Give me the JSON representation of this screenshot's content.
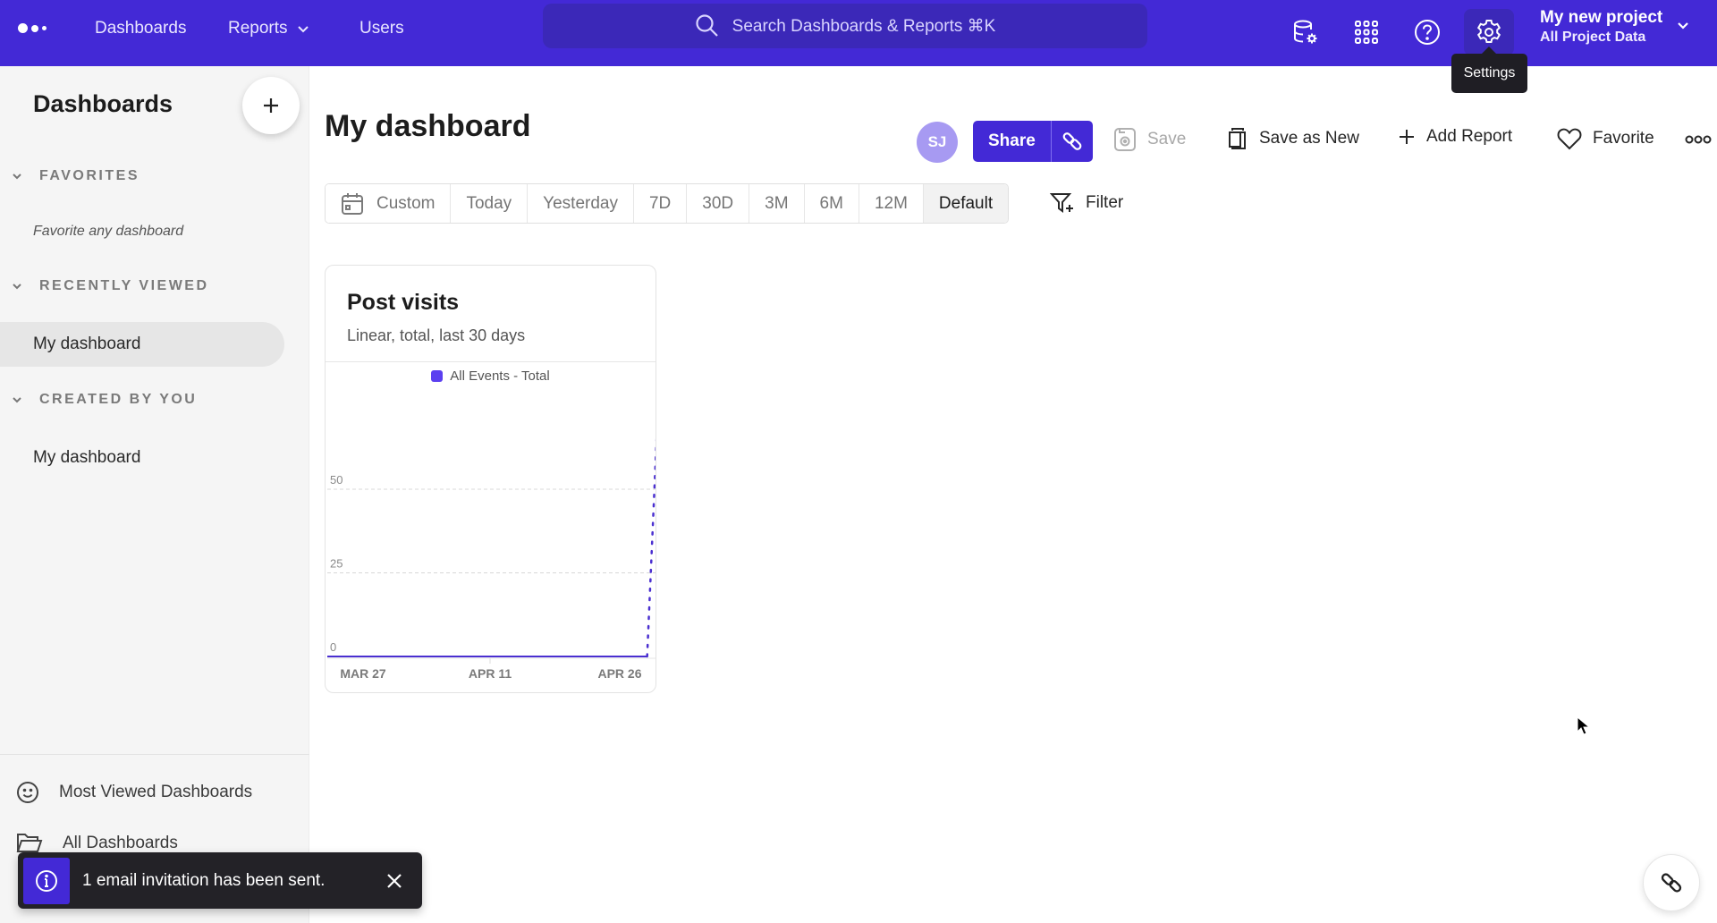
{
  "topbar": {
    "nav": [
      {
        "label": "Dashboards"
      },
      {
        "label": "Reports",
        "has_dropdown": true
      },
      {
        "label": "Users"
      }
    ],
    "search_placeholder": "Search Dashboards & Reports ⌘K",
    "icons": [
      "data-settings-icon",
      "apps-grid-icon",
      "help-icon",
      "settings-icon"
    ],
    "active_icon": "settings-icon",
    "tooltip": "Settings",
    "project": {
      "name": "My new project",
      "subtitle": "All Project Data"
    },
    "brand_color": "#4329d6"
  },
  "sidebar": {
    "title": "Dashboards",
    "sections": [
      {
        "label": "FAVORITES",
        "empty_text": "Favorite any dashboard",
        "items": []
      },
      {
        "label": "RECENTLY VIEWED",
        "items": [
          {
            "label": "My dashboard",
            "active": true
          }
        ]
      },
      {
        "label": "CREATED BY YOU",
        "items": [
          {
            "label": "My dashboard",
            "active": false
          }
        ]
      }
    ],
    "links": [
      {
        "label": "Most Viewed Dashboards",
        "icon": "smiley-icon"
      },
      {
        "label": "All Dashboards",
        "icon": "folder-icon"
      }
    ]
  },
  "header": {
    "title": "My dashboard",
    "avatar_initials": "SJ",
    "share_label": "Share",
    "save_label": "Save",
    "save_as_new_label": "Save as New",
    "add_report_label": "Add Report",
    "favorite_label": "Favorite"
  },
  "date_range": {
    "options": [
      "Custom",
      "Today",
      "Yesterday",
      "7D",
      "30D",
      "3M",
      "6M",
      "12M",
      "Default"
    ],
    "selected": "Default",
    "filter_label": "Filter"
  },
  "card": {
    "title": "Post visits",
    "subtitle": "Linear, total, last 30 days"
  },
  "chart_data": {
    "type": "line",
    "title": "Post visits",
    "subtitle": "Linear, total, last 30 days",
    "legend": [
      {
        "name": "All Events - Total",
        "color": "#5b3ff0"
      }
    ],
    "legend_position": "top-center",
    "x_ticks": [
      "MAR 27",
      "APR 11",
      "APR 26"
    ],
    "y_ticks": [
      0,
      25,
      50
    ],
    "ylim": [
      0,
      75
    ],
    "grid": true,
    "series": [
      {
        "name": "All Events - Total",
        "solid_values": [
          0,
          0,
          0,
          0,
          0,
          0,
          0,
          0,
          0,
          0,
          0,
          0,
          0,
          0,
          0,
          0,
          0,
          0,
          0,
          0,
          0,
          0,
          0,
          0,
          0,
          0,
          0,
          0,
          0,
          0
        ],
        "partial_period_value": 76,
        "partial_period_style": "dotted"
      }
    ]
  },
  "toast": {
    "message": "1 email invitation has been sent."
  }
}
